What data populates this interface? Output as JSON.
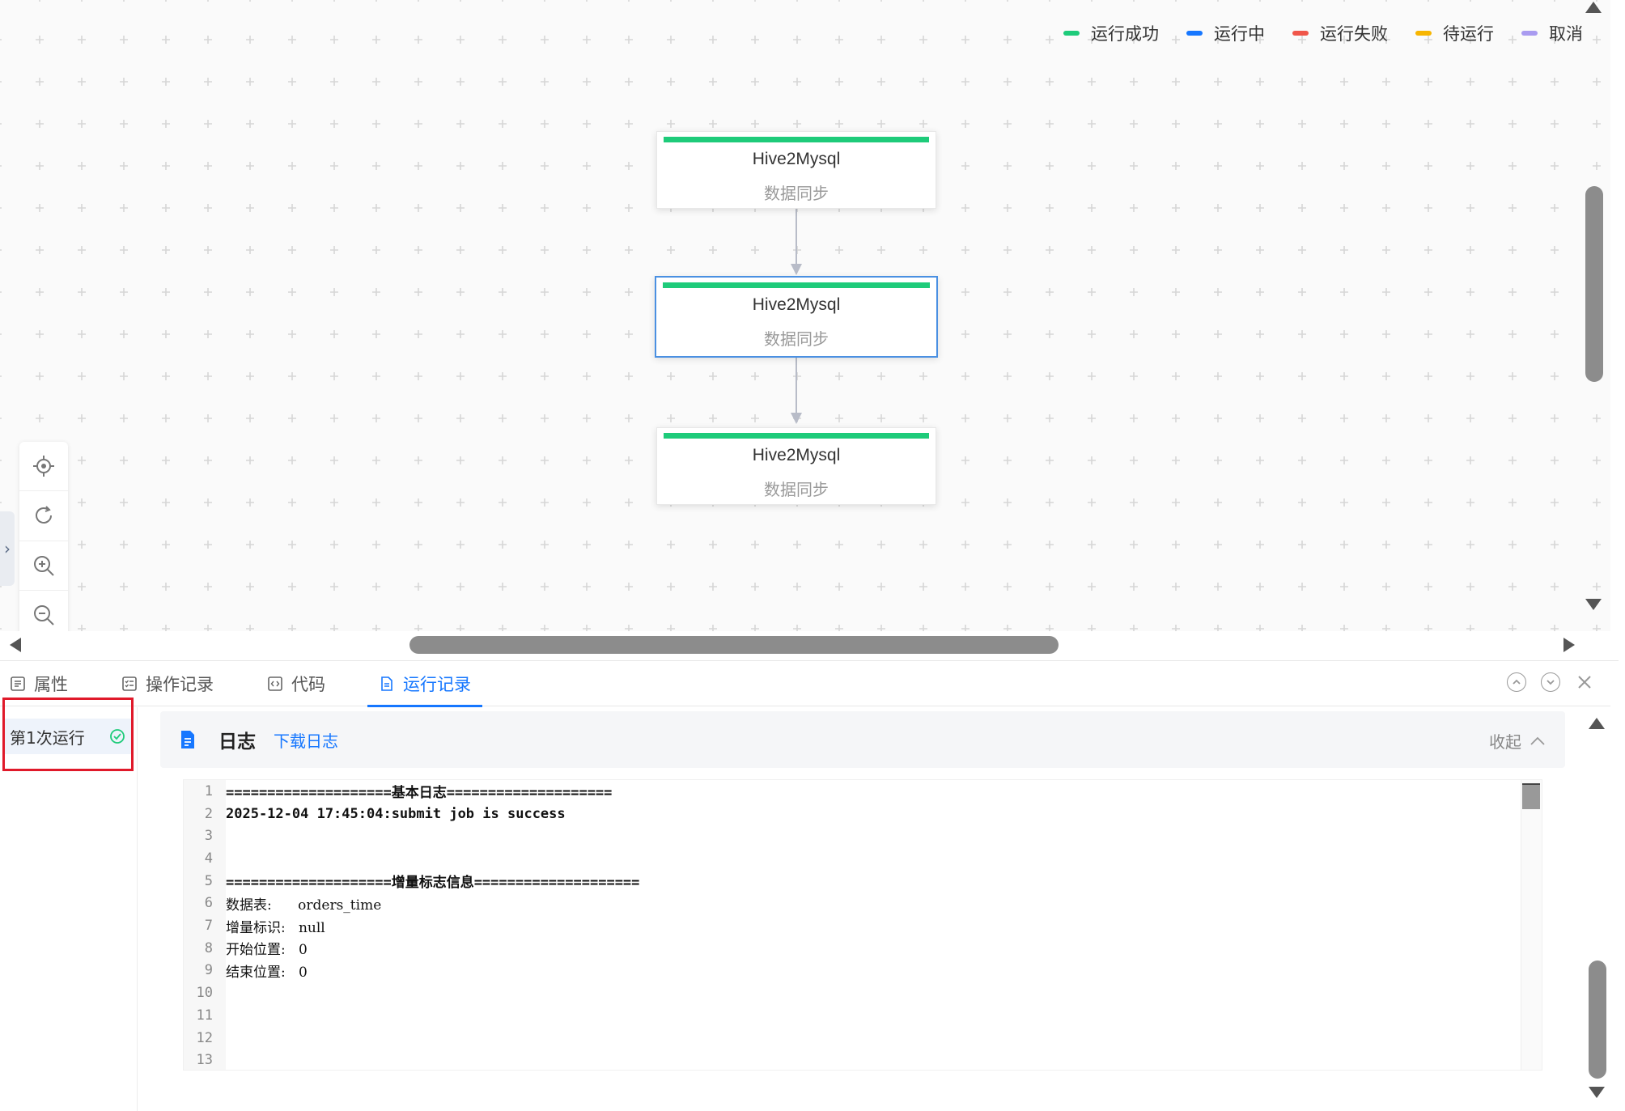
{
  "legend": [
    {
      "label": "运行成功",
      "color": "#1ecb7a"
    },
    {
      "label": "运行中",
      "color": "#1677ff"
    },
    {
      "label": "运行失败",
      "color": "#f0564a"
    },
    {
      "label": "待运行",
      "color": "#f7b500"
    },
    {
      "label": "取消",
      "color": "#a99bf0"
    }
  ],
  "nodes": [
    {
      "title": "Hive2Mysql",
      "subtitle": "数据同步",
      "status_color": "#1ecb7a",
      "selected": false
    },
    {
      "title": "Hive2Mysql",
      "subtitle": "数据同步",
      "status_color": "#1ecb7a",
      "selected": true
    },
    {
      "title": "Hive2Mysql",
      "subtitle": "数据同步",
      "status_color": "#1ecb7a",
      "selected": false
    }
  ],
  "canvas_toolbar": [
    "locate-icon",
    "refresh-icon",
    "zoom-in-icon",
    "zoom-out-icon"
  ],
  "side_toggle": "›",
  "tabs": [
    {
      "label": "属性",
      "icon": "list-icon",
      "active": false
    },
    {
      "label": "操作记录",
      "icon": "checklist-icon",
      "active": false
    },
    {
      "label": "代码",
      "icon": "code-icon",
      "active": false
    },
    {
      "label": "运行记录",
      "icon": "document-icon",
      "active": true
    }
  ],
  "run_list": [
    {
      "label": "第1次运行",
      "status_icon": "check-circle-icon",
      "status_color": "#1ecb7a"
    }
  ],
  "log": {
    "title": "日志",
    "download_label": "下载日志",
    "collapse_label": "收起",
    "lines": [
      "====================基本日志====================",
      "2025-12-04 17:45:04:submit job is success",
      "",
      "",
      "====================增量标志信息====================",
      "数据表:      orders_time",
      "增量标识:   null",
      "开始位置:   0",
      "结束位置:   0",
      "",
      "",
      "",
      ""
    ]
  },
  "colors": {
    "accent": "#1677ff",
    "success": "#1ecb7a",
    "highlight_box": "#e0192a"
  }
}
